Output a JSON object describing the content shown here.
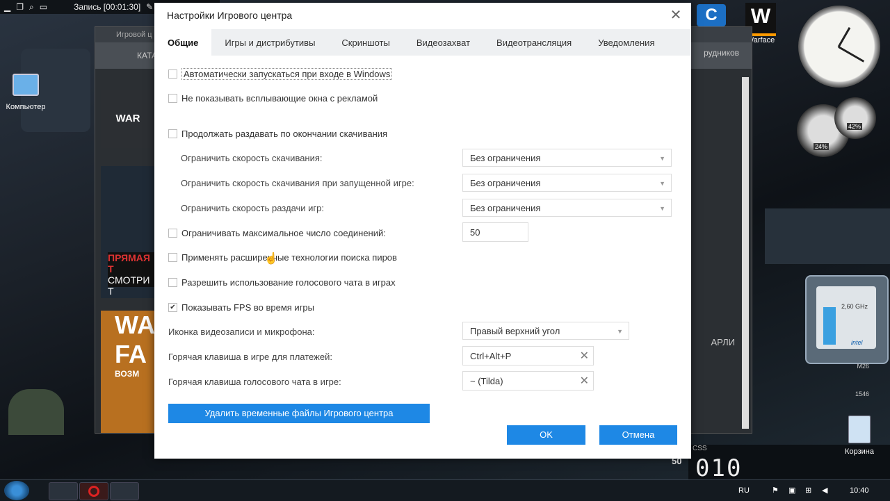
{
  "recorder": {
    "label": "Запись [00:01:30]"
  },
  "desktop": {
    "computer_label": "Компьютер",
    "warface_label": "Warface",
    "trash_label": "Корзина",
    "gauge_left": "24%",
    "gauge_right": "42%",
    "cpu_freq": "2,60 GHz",
    "cpu_brand": "intel"
  },
  "bg_window": {
    "title": "Игровой ц",
    "nav_text": "КАТА",
    "right_menu": "рудников",
    "right_label": "АРЛИ",
    "promo1": "ПРЯМАЯ Т",
    "promo2": "СМОТРИ Т",
    "game1": "WAR FACE",
    "game2": "WA FA",
    "game2_sub": "ВОЗМ"
  },
  "dialog": {
    "title": "Настройки Игрового центра",
    "tabs": [
      {
        "label": "Общие",
        "active": true
      },
      {
        "label": "Игры и дистрибутивы"
      },
      {
        "label": "Скриншоты"
      },
      {
        "label": "Видеозахват"
      },
      {
        "label": "Видеотрансляция"
      },
      {
        "label": "Уведомления"
      }
    ],
    "options": {
      "autostart": {
        "label": "Автоматически запускаться при входе в Windows",
        "checked": false
      },
      "no_ads": {
        "label": "Не показывать всплывающие окна с рекламой",
        "checked": false
      },
      "keep_seeding": {
        "label": "Продолжать раздавать по окончании скачивания",
        "checked": false
      },
      "max_connections": {
        "label": "Ограничивать максимальное число соединений:",
        "checked": false,
        "value": "50"
      },
      "advanced_peers": {
        "label": "Применять расширенные технологии поиска пиров",
        "checked": false
      },
      "voice_chat": {
        "label": "Разрешить использование голосового чата в играх",
        "checked": false
      },
      "show_fps": {
        "label": "Показывать FPS во время игры",
        "checked": true
      }
    },
    "limits": {
      "download": {
        "label": "Ограничить скорость скачивания:",
        "value": "Без ограничения"
      },
      "download_ingame": {
        "label": "Ограничить скорость скачивания при запущенной игре:",
        "value": "Без ограничения"
      },
      "seeding": {
        "label": "Ограничить скорость раздачи игр:",
        "value": "Без ограничения"
      }
    },
    "video_icon": {
      "label": "Иконка видеозаписи и микрофона:",
      "value": "Правый верхний угол"
    },
    "hotkey_payments": {
      "label": "Горячая клавиша в игре для платежей:",
      "value": "Ctrl+Alt+P"
    },
    "hotkey_voice": {
      "label": "Горячая клавиша голосового чата в игре:",
      "value": "~ (Tilda)"
    },
    "delete_temp_label": "Удалить временные файлы Игрового центра",
    "ok_label": "OK",
    "cancel_label": "Отмена"
  },
  "hud": {
    "left_num": "50",
    "score": "010",
    "css": "CSS"
  },
  "taskbar": {
    "lang": "RU",
    "time": "10:40"
  }
}
